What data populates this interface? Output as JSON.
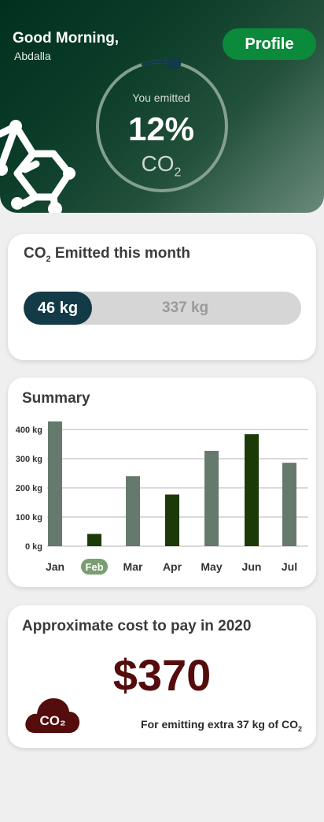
{
  "header": {
    "greeting": "Good Morning,",
    "username": "Abdalla",
    "profile_label": "Profile",
    "emitted_caption": "You emitted",
    "emitted_percent": "12%",
    "emitted_fraction": 0.12,
    "unit_main": "CO",
    "unit_sub": "2"
  },
  "monthly": {
    "title_main": "CO",
    "title_sub": "2",
    "title_rest": " Emitted this month",
    "current_label": "46 kg",
    "total_label": "337 kg",
    "current_value": 46,
    "total_value": 337
  },
  "summary": {
    "title": "Summary"
  },
  "chart_data": {
    "type": "bar",
    "title": "Summary",
    "categories": [
      "Jan",
      "Feb",
      "Mar",
      "Apr",
      "May",
      "Jun",
      "Jul"
    ],
    "values": [
      428,
      42,
      240,
      177,
      327,
      384,
      286
    ],
    "selected": "Feb",
    "ylim": [
      0,
      400
    ],
    "yticks": [
      0,
      100,
      200,
      300,
      400
    ],
    "ytick_labels": [
      "0 kg",
      "100 kg",
      "200 kg",
      "300 kg",
      "400 kg"
    ],
    "bar_colors": [
      "#657a6c",
      "#1b3a07",
      "#657a6c",
      "#1b3a07",
      "#657a6c",
      "#1b3a07",
      "#657a6c"
    ],
    "selected_color": "#7a9e72",
    "grid": true
  },
  "cost": {
    "title": "Approximate cost to pay in 2020",
    "amount": "$370",
    "note_main": "For emitting extra 37 kg of CO",
    "note_sub": "2",
    "icon": "co2-cloud-icon",
    "icon_label": "CO₂"
  },
  "colors": {
    "accent_green": "#0a8a3a",
    "progress_fill": "#123a47",
    "cost_red": "#540c0c"
  }
}
